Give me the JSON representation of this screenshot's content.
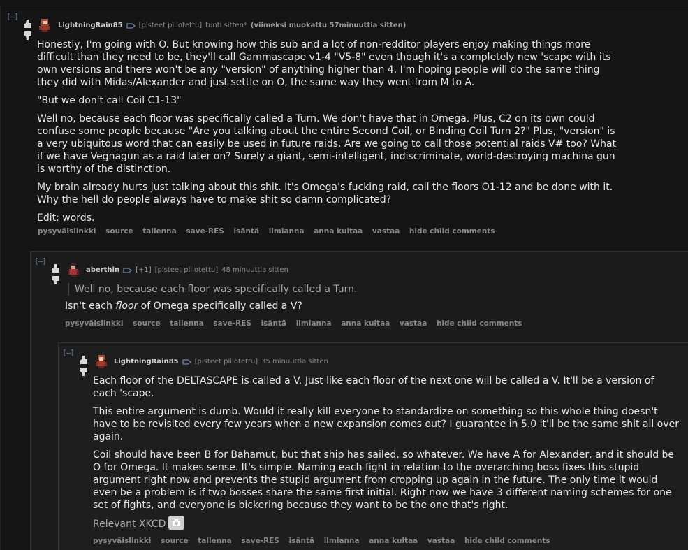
{
  "comments": [
    {
      "toggle": "[–]",
      "author": "LightningRain85",
      "score": "[pisteet piilotettu]",
      "time": "tunti sitten*",
      "edited": "(viimeksi muokattu 57minuuttia sitten)",
      "paragraphs": [
        "Honestly, I'm going with O. But knowing how this sub and a lot of non-redditor players enjoy making things more difficult than they need to be, they'll call Gammascape v1-4 \"V5-8\" even though it's a completely new 'scape with its own versions and there won't be any \"version\" of anything higher than 4. I'm hoping people will do the same thing they did with Midas/Alexander and just settle on O, the same way they went from M to A.",
        "\"But we don't call Coil C1-13\"",
        "Well no, because each floor was specifically called a Turn. We don't have that in Omega. Plus, C2 on its own could confuse some people because \"Are you talking about the entire Second Coil, or Binding Coil Turn 2?\" Plus, \"version\" is a very ubiquitous word that can easily be used in future raids. Are we going to call those potential raids V# too? What if we have Vegnagun as a raid later on? Surely a giant, semi-intelligent, indiscriminate, world-destroying machina gun is worthy of the distinction.",
        "My brain already hurts just talking about this shit. It's Omega's fucking raid, call the floors O1-12 and be done with it. Why the hell do people always have to make shit so damn complicated?",
        "Edit: words."
      ],
      "buttons": [
        "pysyväislinkki",
        "source",
        "tallenna",
        "save-RES",
        "isäntä",
        "ilmianna",
        "anna kultaa",
        "vastaa",
        "hide child comments"
      ]
    },
    {
      "toggle": "[–]",
      "author": "aberthin",
      "flair": "[+1]",
      "score": "[pisteet piilotettu]",
      "time": "48 minuuttia sitten",
      "quote": "Well no, because each floor was specifically called a Turn.",
      "text_before": "Isn't each ",
      "text_em": "floor",
      "text_after": " of Omega specifically called a V?",
      "buttons": [
        "pysyväislinkki",
        "source",
        "tallenna",
        "save-RES",
        "isäntä",
        "ilmianna",
        "anna kultaa",
        "vastaa",
        "hide child comments"
      ]
    },
    {
      "toggle": "[–]",
      "author": "LightningRain85",
      "score": "[pisteet piilotettu]",
      "time": "35 minuuttia sitten",
      "paragraphs": [
        "Each floor of the DELTASCAPE is called a V. Just like each floor of the next one will be called a V. It'll be a version of each 'scape.",
        "This entire argument is dumb. Would it really kill everyone to standardize on something so this whole thing doesn't have to be revisited every few years when a new expansion comes out? I guarantee in 5.0 it'll be the same shit all over again.",
        "Coil should have been B for Bahamut, but that ship has sailed, so whatever. We have A for Alexander, and it should be O for Omega. It makes sense. It's simple. Naming each fight in relation to the overarching boss fixes this stupid argument right now and prevents the stupid argument from cropping up again in the future. The only time it would even be a problem is if two bosses share the same first initial. Right now we have 3 different naming schemes for one set of fights, and everyone is bickering because they want to be the one that's right."
      ],
      "link_text": "Relevant XKCD",
      "buttons": [
        "pysyväislinkki",
        "source",
        "tallenna",
        "save-RES",
        "isäntä",
        "ilmianna",
        "anna kultaa",
        "vastaa",
        "hide child comments"
      ]
    }
  ],
  "icons": {
    "upvote": "upvote-arrow-icon",
    "downvote": "downvote-arrow-icon",
    "avatar": "user-avatar-icon",
    "tag": "user-tag-icon",
    "image": "camera-icon"
  },
  "colors": {
    "background": "#141414",
    "text": "#e6e6e6",
    "muted": "#888888",
    "toggle": "#6a86a8"
  }
}
